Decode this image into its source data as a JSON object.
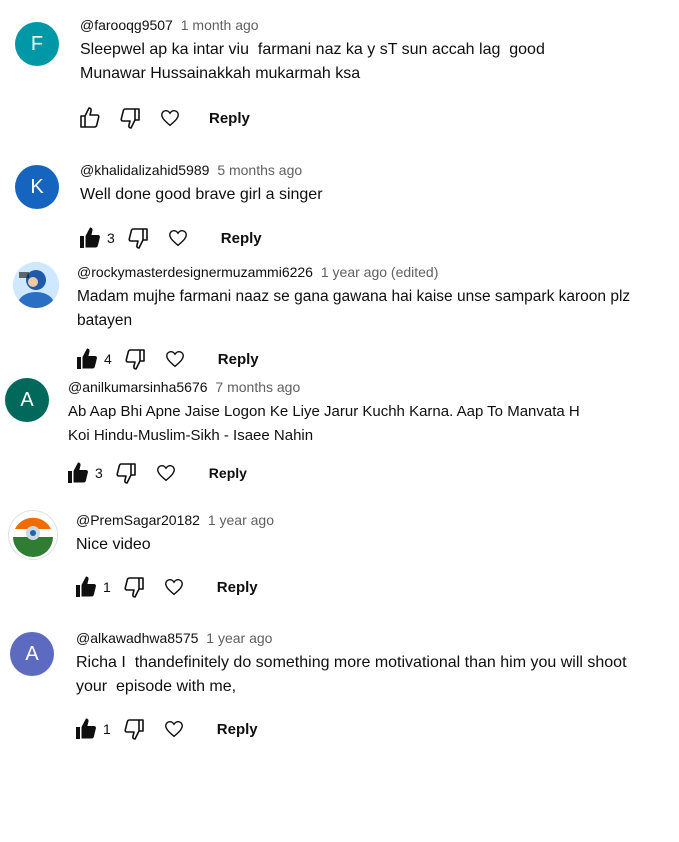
{
  "colors": {
    "text": "#0f0f0f",
    "secondary": "#606060"
  },
  "reply_label": "Reply",
  "comments": [
    {
      "avatar_letter": "F",
      "avatar_color": "#0097a7",
      "handle": "@farooqg9507",
      "time": "1 month ago",
      "text": "Sleepwel ap ka intar viu  farmani naz ka y sT sun accah lag  good\nMunawar Hussainakkah mukarmah ksa",
      "likes": "",
      "liked": false
    },
    {
      "avatar_letter": "K",
      "avatar_color": "#1565c0",
      "handle": "@khalidalizahid5989",
      "time": "5 months ago",
      "text": "Well done good brave girl a singer",
      "likes": "3",
      "liked": true
    },
    {
      "avatar_letter": "",
      "avatar_color": "#ffffff",
      "handle": "@rockymasterdesignermuzammi6226",
      "time": "1 year ago (edited)",
      "text": "Madam mujhe farmani naaz se gana gawana hai kaise unse sampark karoon plz\nbatayen",
      "likes": "4",
      "liked": true
    },
    {
      "avatar_letter": "A",
      "avatar_color": "#00695c",
      "handle": "@anilkumarsinha5676",
      "time": "7 months ago",
      "text": "Ab Aap Bhi Apne Jaise Logon Ke Liye Jarur Kuchh Karna. Aap To Manvata H\nKoi Hindu-Muslim-Sikh - Isaee Nahin",
      "likes": "3",
      "liked": true
    },
    {
      "avatar_letter": "",
      "avatar_color": "#ffffff",
      "handle": "@PremSagar20182",
      "time": "1 year ago",
      "text": "Nice video",
      "likes": "1",
      "liked": true
    },
    {
      "avatar_letter": "A",
      "avatar_color": "#5c6bc0",
      "handle": "@alkawadhwa8575",
      "time": "1 year ago",
      "text": "Richa I  thandefinitely do something more motivational than him you will shoot\nyour  episode with me,",
      "likes": "1",
      "liked": true
    }
  ]
}
